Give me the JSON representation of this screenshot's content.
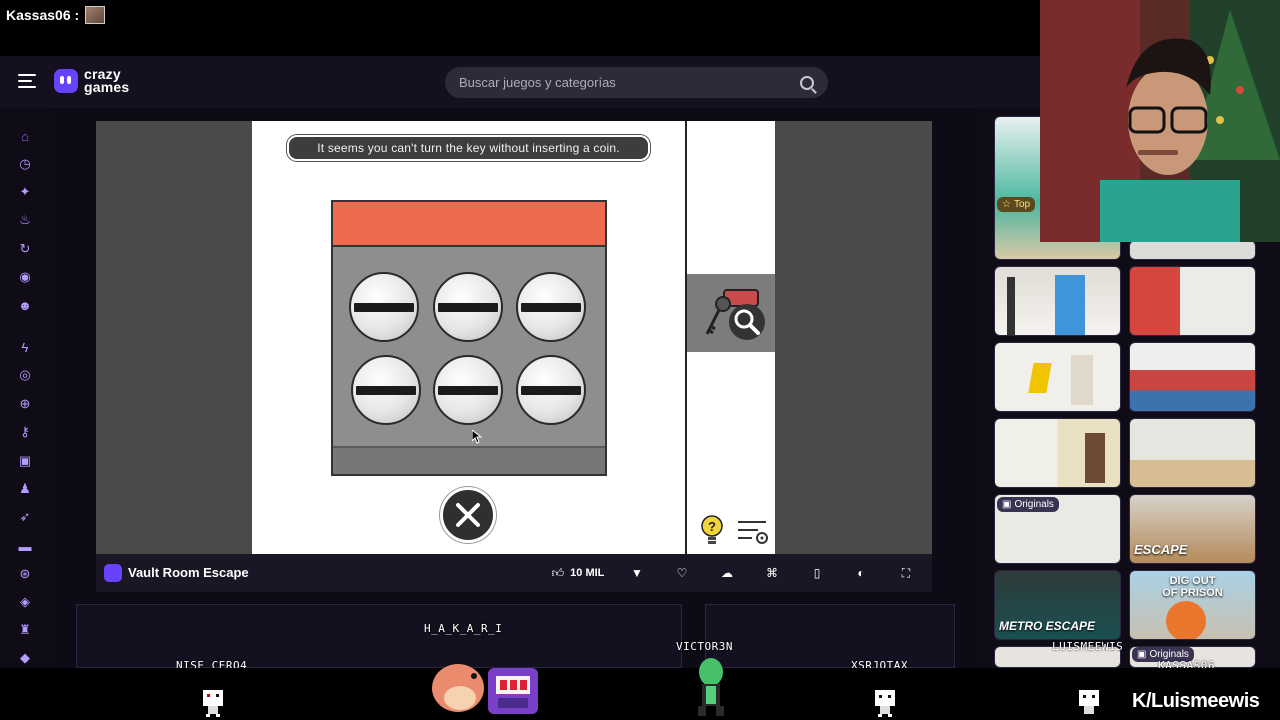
{
  "stream": {
    "user_label": "Kassas06 :"
  },
  "header": {
    "logo_line1": "crazy",
    "logo_line2": "games",
    "search_placeholder": "Buscar juegos y categorías"
  },
  "sidebar": {
    "icons": [
      "home-icon",
      "clock-icon",
      "sparkle-icon",
      "flame-icon",
      "refresh-icon",
      "badge-icon",
      "users-icon",
      "bolt-icon",
      "compass-icon",
      "basketball-icon",
      "key-icon",
      "puzzle-icon",
      "user-icon",
      "rocket-icon",
      "car-icon",
      "steering-icon",
      "gamepad-icon",
      "figure-icon",
      "tag-icon"
    ]
  },
  "game": {
    "message": "It seems you can't turn the key without inserting a coin.",
    "title": "Vault Room Escape",
    "like_count": "10 MIL",
    "colors": {
      "machine_top": "#ee6a4f",
      "machine_body": "#8e8e8e"
    }
  },
  "recommended": {
    "top_badge": "Top",
    "originals_badge": "Originals",
    "originals_badge2": "Originals",
    "escape_label": "ESCAPE",
    "metro_label": "METRO ESCAPE",
    "prison_label_1": "DIG OUT",
    "prison_label_2": "OF PRISON"
  },
  "stream_overlay": {
    "names": [
      "H_A_K_A_R_I",
      "NISE_CERO4",
      "VICTOR3N",
      "XSRJOTAX",
      "LUISMEEWIS",
      "KASSAS06"
    ],
    "brand": "K/Luismeewis"
  }
}
